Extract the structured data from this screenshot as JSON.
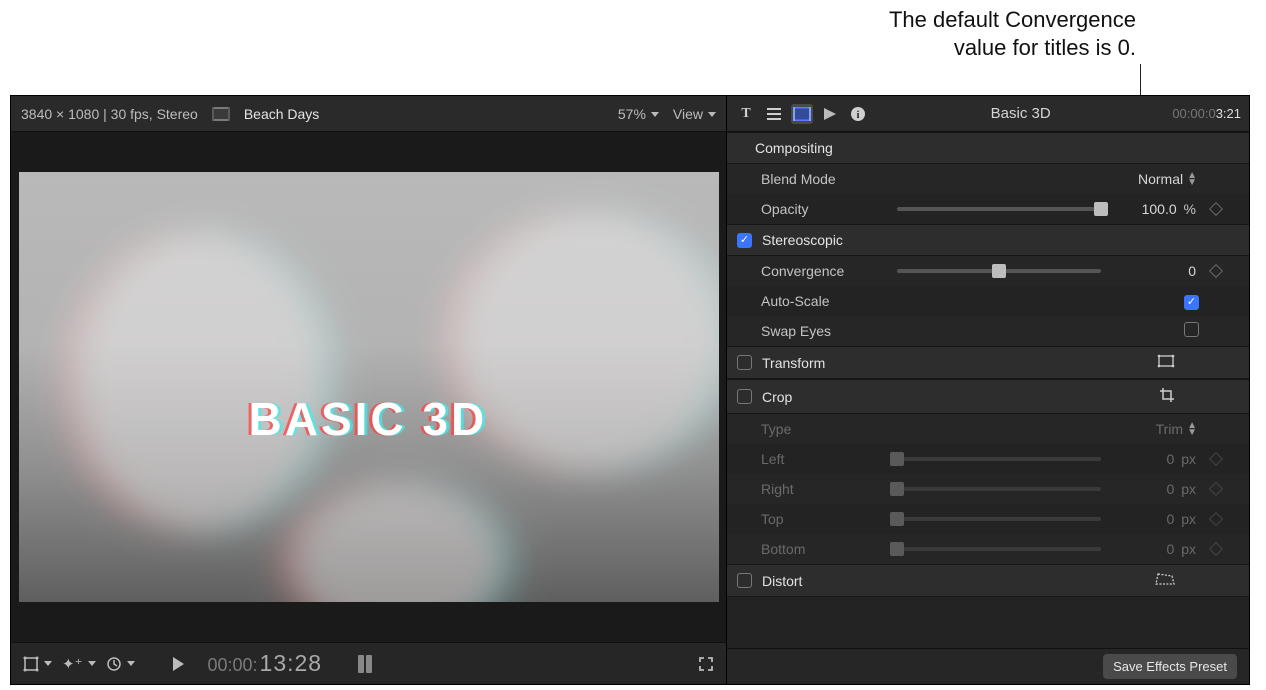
{
  "annotation": {
    "line1": "The default Convergence",
    "line2": "value for titles is 0."
  },
  "viewer_header": {
    "resolution": "3840 × 1080 | 30 fps, Stereo",
    "clip_name": "Beach Days",
    "zoom": "57%",
    "view_label": "View"
  },
  "viewer_overlay_title": "BASIC 3D",
  "transport": {
    "timecode_small": "00:00:",
    "timecode_large": "13:28"
  },
  "inspector": {
    "title": "Basic 3D",
    "timecode_prefix": "00:00:0",
    "timecode_suffix": "3:21",
    "sections": {
      "compositing": {
        "label": "Compositing",
        "blend_mode": {
          "label": "Blend Mode",
          "value": "Normal"
        },
        "opacity": {
          "label": "Opacity",
          "value": "100.0",
          "unit": "%"
        }
      },
      "stereoscopic": {
        "label": "Stereoscopic",
        "checked": true,
        "convergence": {
          "label": "Convergence",
          "value": "0"
        },
        "auto_scale": {
          "label": "Auto-Scale",
          "checked": true
        },
        "swap_eyes": {
          "label": "Swap Eyes",
          "checked": false
        }
      },
      "transform": {
        "label": "Transform",
        "checked": false
      },
      "crop": {
        "label": "Crop",
        "checked": false,
        "type": {
          "label": "Type",
          "value": "Trim"
        },
        "left": {
          "label": "Left",
          "value": "0",
          "unit": "px"
        },
        "right": {
          "label": "Right",
          "value": "0",
          "unit": "px"
        },
        "top": {
          "label": "Top",
          "value": "0",
          "unit": "px"
        },
        "bottom": {
          "label": "Bottom",
          "value": "0",
          "unit": "px"
        }
      },
      "distort": {
        "label": "Distort",
        "checked": false
      }
    },
    "footer_button": "Save Effects Preset"
  }
}
